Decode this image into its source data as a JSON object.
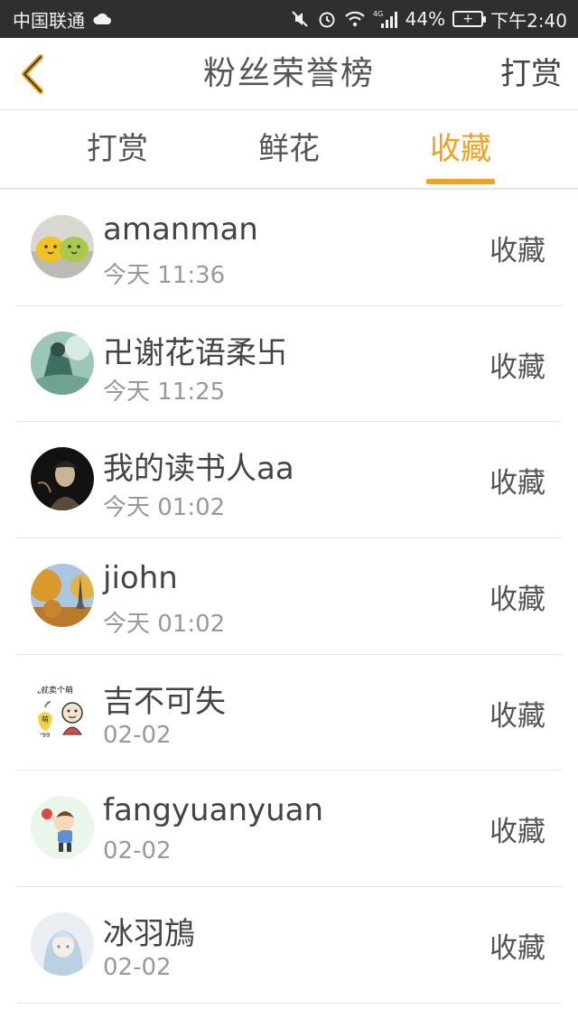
{
  "status_bar": {
    "carrier": "中国联通",
    "battery_percent": "44%",
    "battery_level": 44,
    "network": "4G",
    "time": "下午2:40"
  },
  "header": {
    "title": "粉丝荣誉榜",
    "action_label": "打赏",
    "back_icon": "chevron-left-icon",
    "accent_color": "#f0a21f"
  },
  "tabs": [
    {
      "label": "打赏",
      "active": false
    },
    {
      "label": "鲜花",
      "active": false
    },
    {
      "label": "收藏",
      "active": true
    }
  ],
  "list": [
    {
      "name": "amanman",
      "time": "今天 11:36",
      "action": "收藏",
      "avatar": "avatar-yellow-green-blobs"
    },
    {
      "name": "卍谢花语柔卐",
      "time": "今天 11:25",
      "action": "收藏",
      "avatar": "avatar-teal-illustration"
    },
    {
      "name": "我的读书人aa",
      "time": "今天 01:02",
      "action": "收藏",
      "avatar": "avatar-dark-portrait"
    },
    {
      "name": "jiohn",
      "time": "今天 01:02",
      "action": "收藏",
      "avatar": "avatar-autumn-eiffel"
    },
    {
      "name": "吉不可失",
      "time": "02-02",
      "action": "收藏",
      "avatar": "avatar-cartoon-meme"
    },
    {
      "name": "fangyuanyuan",
      "time": "02-02",
      "action": "收藏",
      "avatar": "avatar-cartoon-boy"
    },
    {
      "name": "冰羽鴋",
      "time": "02-02",
      "action": "收藏",
      "avatar": "avatar-anime-girl"
    }
  ],
  "avatar_text": {
    "meme_caption": "我就卖个萌",
    "meme_badge": "萌",
    "meme_price": "¥99"
  }
}
